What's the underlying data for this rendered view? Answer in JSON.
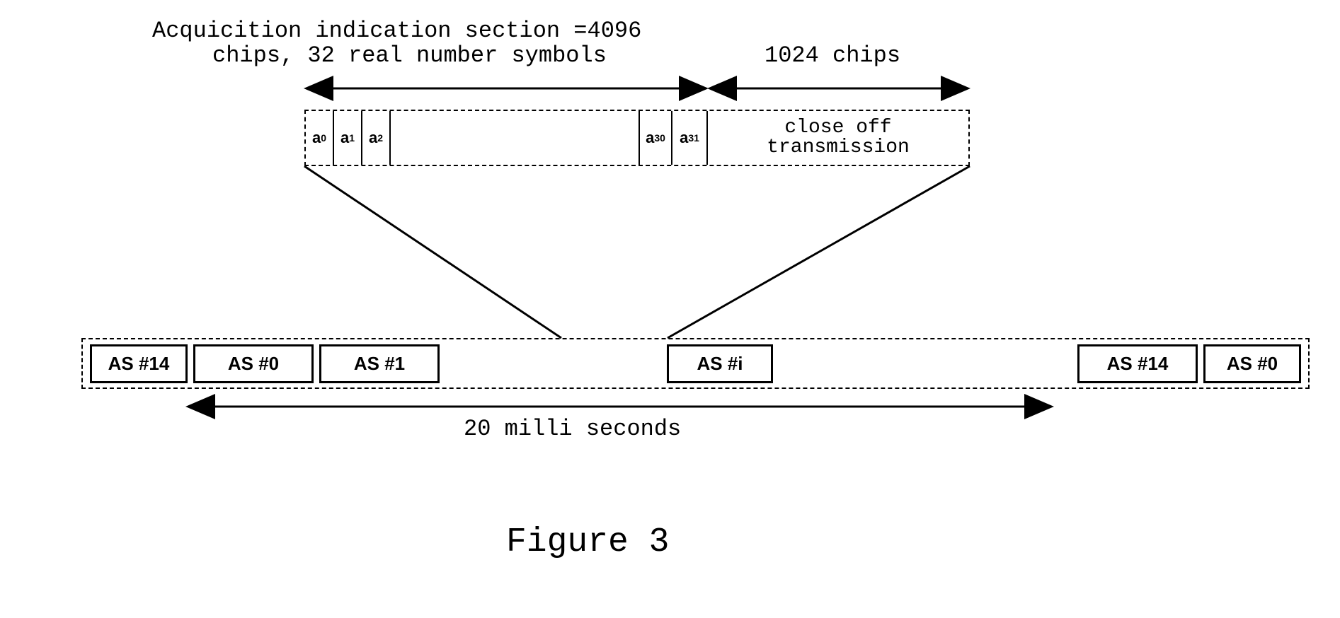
{
  "labels": {
    "acq_line1": "Acquicition indication section =4096",
    "acq_line2": "chips, 32 real number symbols",
    "chips_1024": "1024 chips",
    "close_off_line1": "close off",
    "close_off_line2": "transmission",
    "duration": "20 milli seconds",
    "figure": "Figure 3"
  },
  "symbols": {
    "a0": "a",
    "a0_sub": "0",
    "a1": "a",
    "a1_sub": "1",
    "a2": "a",
    "a2_sub": "2",
    "a30": "a",
    "a30_sub": "30",
    "a31": "a",
    "a31_sub": "31"
  },
  "slots": {
    "s0": "AS #14",
    "s1": "AS #0",
    "s2": "AS #1",
    "s3": "AS #i",
    "s4": "AS #14",
    "s5": "AS #0"
  }
}
